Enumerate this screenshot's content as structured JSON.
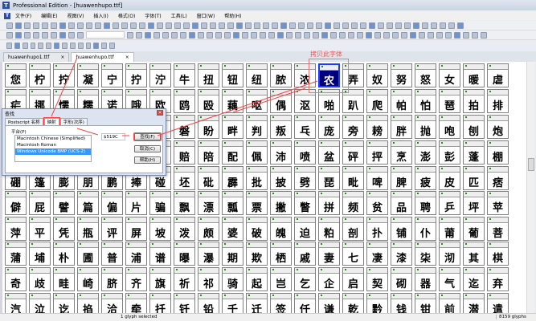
{
  "window": {
    "title": "Professional Edition - [huawenhupo.ttf]",
    "app_icon": "T"
  },
  "menu": [
    "文件(F)",
    "编辑(E)",
    "视图(V)",
    "插入(I)",
    "格式(O)",
    "字体(T)",
    "工具(L)",
    "窗口(W)",
    "帮助(H)"
  ],
  "doc_tabs": [
    {
      "label": "huawenhupo1.ttf",
      "close": "×"
    },
    {
      "label": "huawenhupo.ttf",
      "close": "×"
    }
  ],
  "annotation": {
    "label": "拷贝此字体",
    "color": "#ff4f4f"
  },
  "glyph_rows": [
    "您柠拧凝宁拧泞牛扭钮纽脓浓农弄奴努怒女暖虐",
    "疟挪懦糯诺哦欧鸥殴藕呕偶沤啪趴爬帕怕琶拍排",
    "牌徘湃派攀潘盘磐盼畔判叛乓庞旁耪胖抛咆刨炮",
    "袍跑泡呸胚培裴赔陪配佩沛喷盆砰抨烹澎彭蓬棚",
    "硼篷膨朋鹏捧碰坯砒霹批披劈琵毗啤脾疲皮匹痞",
    "僻屁譬篇偏片骗飘漂瓢票撇瞥拼频贫品聘乒坪苹",
    "萍平凭瓶评屏坡泼颇婆破魄迫粕剖扑铺仆莆葡菩",
    "蒲埔朴圃普浦谱曝瀑期欺栖戚妻七凄漆柒沏其棋",
    "奇歧畦崎脐齐旗祈祁骑起岂乞企启契砌器气迄弃",
    "汽泣讫掐洽牵扦钎铅千迁签仟谦乾黔钱钳前潜遣"
  ],
  "selected_glyph": {
    "row": 0,
    "col": 13,
    "char": "农"
  },
  "dialog": {
    "title": "查找",
    "close": "×",
    "tabs": [
      "Postscript 名称",
      "映射",
      "字形(次序)"
    ],
    "active_tab": "映射",
    "group_label": "平台(P)",
    "platforms": [
      "Macintosh Chinese (Simplified)",
      "Macintosh Roman",
      "Windows Unicode BMP (UCS-2)"
    ],
    "selected_platform": "Windows Unicode BMP (UCS-2)",
    "code_value": "$519C",
    "buttons": {
      "find": "查找(F)",
      "cancel": "取消(C)",
      "help": "帮助(H)"
    }
  },
  "status": {
    "selection": "1 glyph selected",
    "count": "8159 glyphs"
  }
}
